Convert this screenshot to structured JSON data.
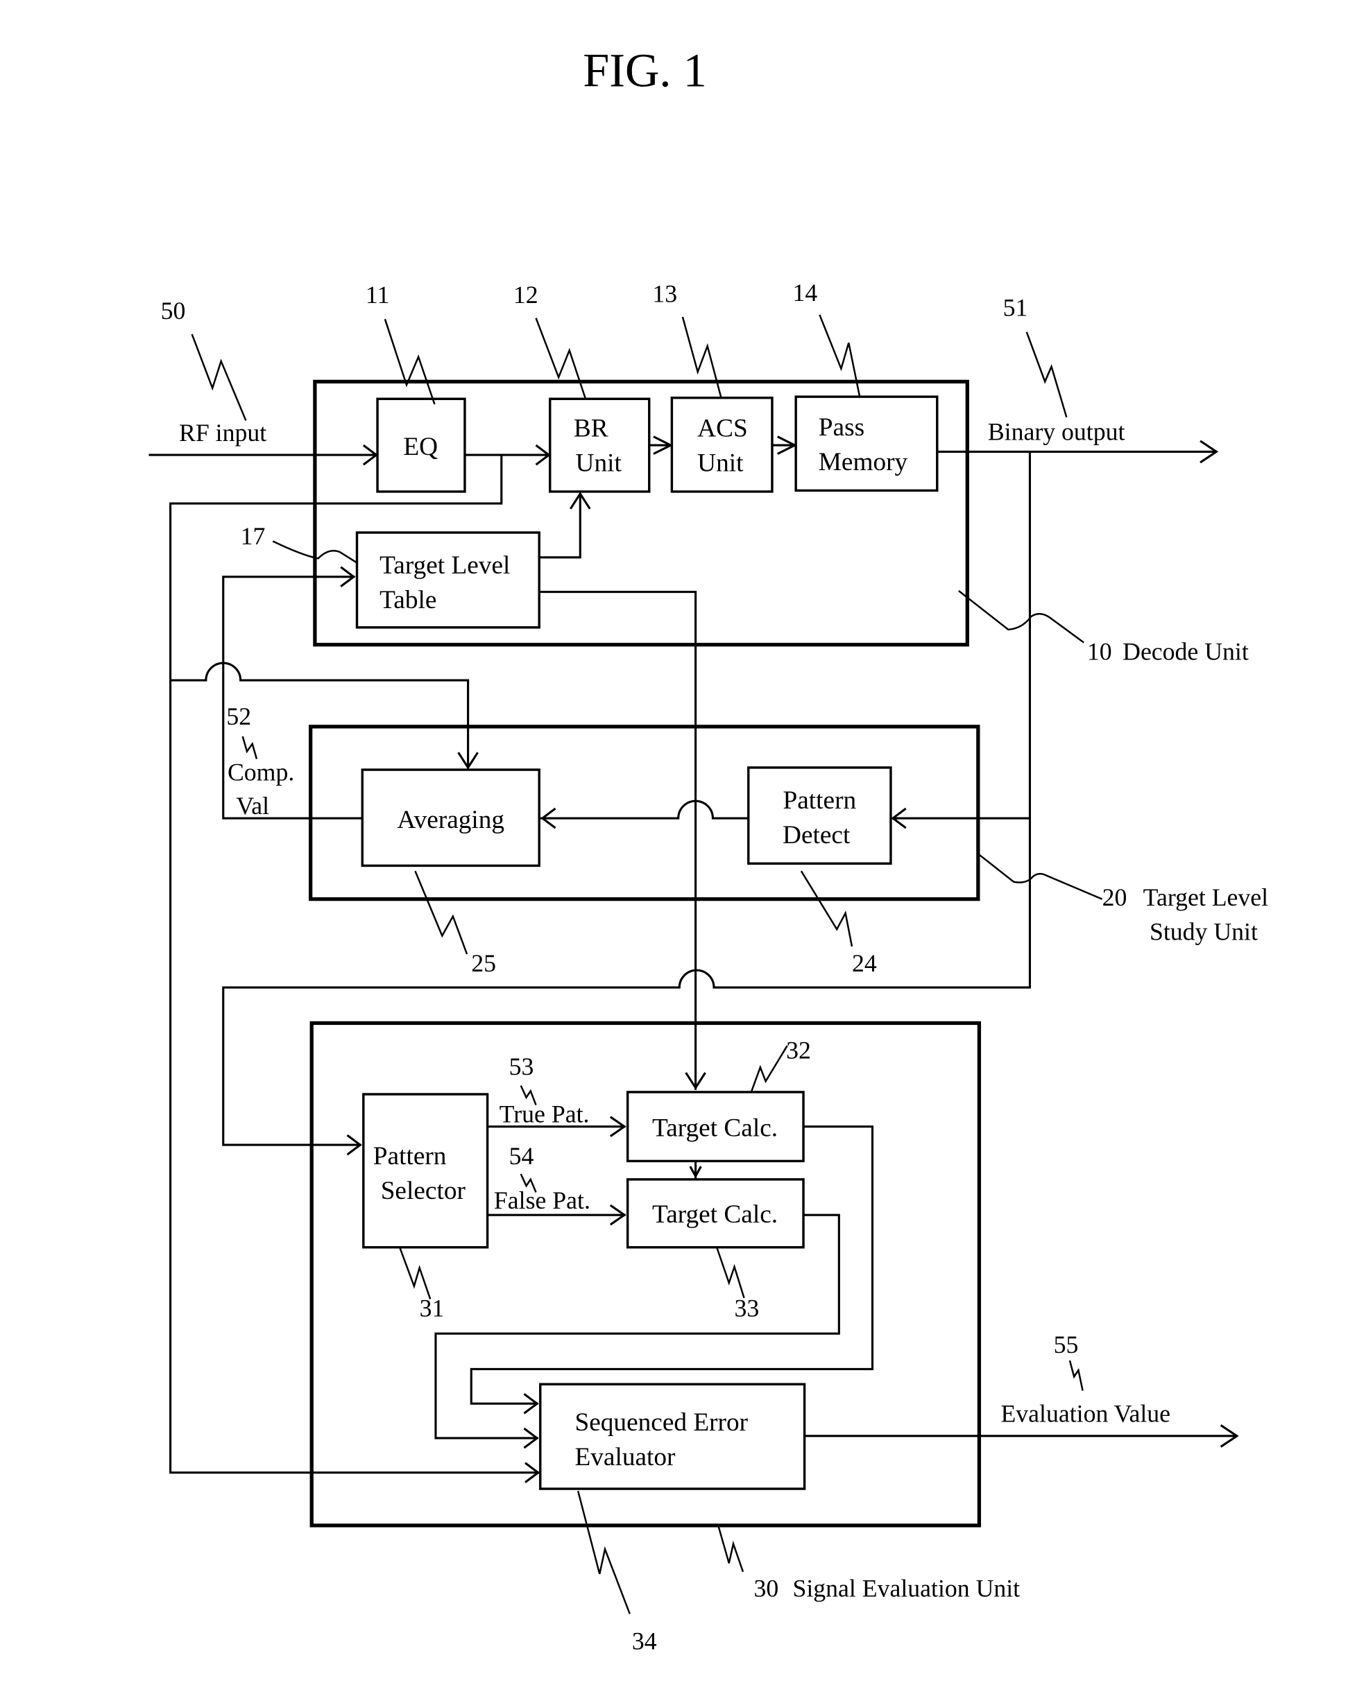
{
  "figure": {
    "title": "FIG. 1"
  },
  "units": {
    "decode": {
      "ref": "10",
      "label": "Decode  Unit"
    },
    "target_level_study": {
      "ref": "20",
      "label_line1": "Target Level",
      "label_line2": "Study  Unit"
    },
    "signal_evaluation": {
      "ref": "30",
      "label": "Signal Evaluation Unit"
    }
  },
  "blocks": {
    "eq": {
      "ref": "11",
      "line1": "EQ"
    },
    "br_unit": {
      "ref": "12",
      "line1": "BR",
      "line2": "Unit"
    },
    "acs_unit": {
      "ref": "13",
      "line1": "ACS",
      "line2": "Unit"
    },
    "pass_memory": {
      "ref": "14",
      "line1": "Pass",
      "line2": "Memory"
    },
    "target_level_table": {
      "ref": "17",
      "line1": "Target Level",
      "line2": "Table"
    },
    "pattern_detect": {
      "ref": "24",
      "line1": "Pattern",
      "line2": "Detect"
    },
    "averaging": {
      "ref": "25",
      "line1": "Averaging"
    },
    "pattern_selector": {
      "ref": "31",
      "line1": "Pattern",
      "line2": "Selector"
    },
    "target_calc_true": {
      "ref": "32",
      "line1": "Target Calc."
    },
    "target_calc_false": {
      "ref": "33",
      "line1": "Target Calc."
    },
    "sequenced_error_evaluator": {
      "ref": "34",
      "line1": "Sequenced Error",
      "line2": "Evaluator"
    }
  },
  "signals": {
    "rf_input": {
      "ref": "50",
      "label": "RF input"
    },
    "binary_output": {
      "ref": "51",
      "label": "Binary output"
    },
    "comp_val": {
      "ref": "52",
      "line1": "Comp.",
      "line2": "Val"
    },
    "true_pat": {
      "ref": "53",
      "label": "True Pat."
    },
    "false_pat": {
      "ref": "54",
      "label": "False Pat."
    },
    "evaluation_value": {
      "ref": "55",
      "label": "Evaluation Value"
    }
  }
}
